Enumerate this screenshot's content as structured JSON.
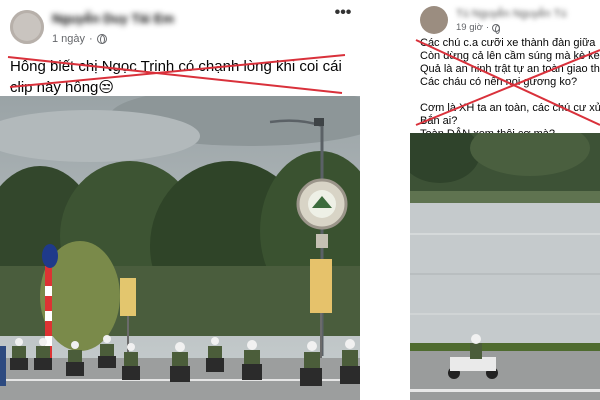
{
  "left_post": {
    "author": "Nguyễn Duy Tài Em",
    "time": "1 ngày",
    "dot": "·",
    "more": "•••",
    "caption_line1": "Hông biết chị Ngọc Trinh có chạnh lòng khi coi cái",
    "caption_line2": "clip này hông😒"
  },
  "right_post": {
    "author": "Tú Nguyễn Nguyễn Tú",
    "time": "19 giờ",
    "dot": "·",
    "lines": [
      "Các chú c.a cưỡi xe thành đàn giữa",
      "Còn dừng cả lên cầm súng mà kè kè",
      "Quả là an ninh trật tự an toàn giao thông",
      "Các cháu có nên noi gương ko?",
      "",
      "Cơm là XH ta an toàn, các chú cư xử",
      "Bắn ai?",
      "Toàn DÂN xem thôi cơ mà?"
    ]
  },
  "colors": {
    "strike": "#d9313b",
    "text": "#050505",
    "meta": "#65676b"
  },
  "icons": {
    "globe": "globe-icon",
    "more": "more-options-icon"
  }
}
